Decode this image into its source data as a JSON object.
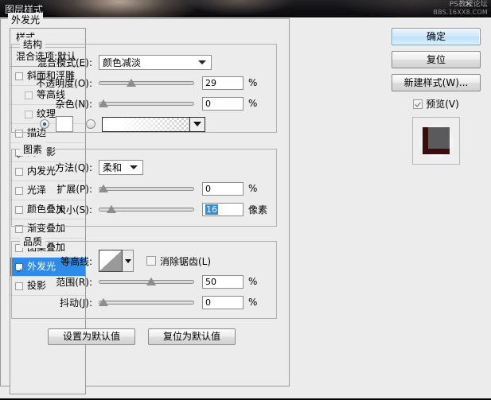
{
  "watermark": {
    "line1": "PS教程论坛",
    "line2": "BBS.16XX8.COM",
    "mark": "✕"
  },
  "window": {
    "title": "图层样式"
  },
  "sidebar": {
    "header": "样式",
    "blending": "混合选项:默认",
    "items": [
      {
        "label": "斜面和浮雕",
        "checked": false,
        "sub": false,
        "selected": false
      },
      {
        "label": "等高线",
        "checked": false,
        "sub": true,
        "selected": false
      },
      {
        "label": "纹理",
        "checked": false,
        "sub": true,
        "selected": false
      },
      {
        "label": "描边",
        "checked": false,
        "sub": false,
        "selected": false
      },
      {
        "label": "内阴影",
        "checked": true,
        "sub": false,
        "selected": false
      },
      {
        "label": "内发光",
        "checked": false,
        "sub": false,
        "selected": false
      },
      {
        "label": "光泽",
        "checked": false,
        "sub": false,
        "selected": false
      },
      {
        "label": "颜色叠加",
        "checked": false,
        "sub": false,
        "selected": false
      },
      {
        "label": "渐变叠加",
        "checked": false,
        "sub": false,
        "selected": false
      },
      {
        "label": "图案叠加",
        "checked": false,
        "sub": false,
        "selected": false
      },
      {
        "label": "外发光",
        "checked": true,
        "sub": false,
        "selected": true
      },
      {
        "label": "投影",
        "checked": false,
        "sub": false,
        "selected": false
      }
    ]
  },
  "main": {
    "title": "外发光",
    "structure": {
      "legend": "结构",
      "blend_mode_label": "混合模式(E):",
      "blend_mode_value": "颜色减淡",
      "opacity_label": "不透明度(O):",
      "opacity_value": "29",
      "opacity_unit": "%",
      "noise_label": "杂色(N):",
      "noise_value": "0",
      "noise_unit": "%",
      "color_radio_selected": true,
      "gradient_radio_selected": false,
      "color_swatch": "#ffffff"
    },
    "elements": {
      "legend": "图素",
      "technique_label": "方法(Q):",
      "technique_value": "柔和",
      "spread_label": "扩展(P):",
      "spread_value": "0",
      "spread_unit": "%",
      "size_label": "大小(S):",
      "size_value": "16",
      "size_unit": "像素"
    },
    "quality": {
      "legend": "品质",
      "contour_label": "等高线:",
      "antialias_label": "消除锯齿(L)",
      "antialias_checked": false,
      "range_label": "范围(R):",
      "range_value": "50",
      "range_unit": "%",
      "jitter_label": "抖动(J):",
      "jitter_value": "0",
      "jitter_unit": "%"
    },
    "footer": {
      "set_default": "设置为默认值",
      "reset_default": "复位为默认值"
    }
  },
  "actions": {
    "ok": "确定",
    "reset": "复位",
    "new_style": "新建样式(W)...",
    "preview_label": "预览(V)",
    "preview_checked": true
  },
  "colors": {
    "accent": "#2f8ae8",
    "dialog_bg": "#ececec",
    "preview_shape": "#3b0d0d",
    "preview_fill": "#5a5a5a"
  }
}
